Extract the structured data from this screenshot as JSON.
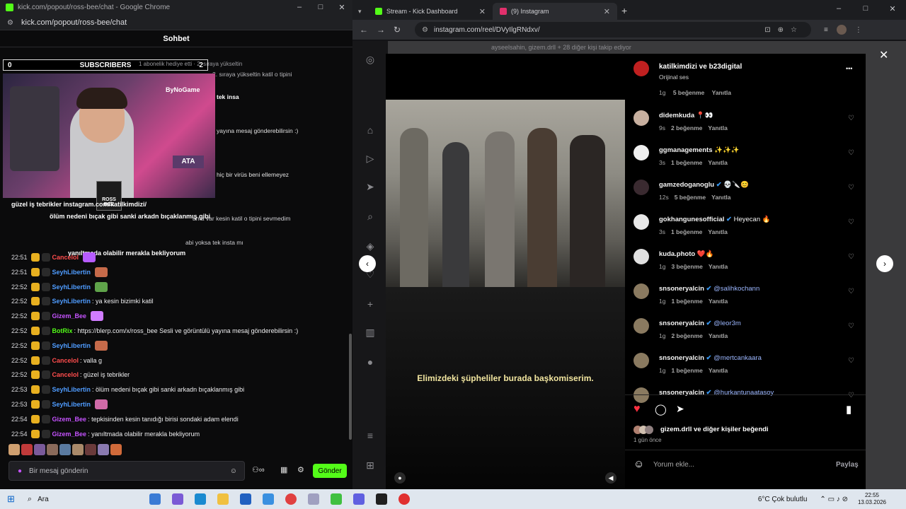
{
  "left_window": {
    "title": "kick.com/popout/ross-bee/chat - Google Chrome",
    "url": "kick.com/popout/ross-bee/chat",
    "controls": [
      "–",
      "□",
      "✕"
    ],
    "chat_title": "Sohbet",
    "sub_bar": {
      "left": "0",
      "center": "SUBSCRIBERS",
      "right": "2"
    },
    "gift_notice": "1 abonelik hediye etti · 2. sıraya yükseltin",
    "overlay_lines": [
      {
        "text": "güzel iş tebrikler instagram.com/katilkimdizi/",
        "color": "#ffffff"
      },
      {
        "text": "ölüm nedeni bıçak gibi sanki arkadn bıçaklanmış gibi",
        "color": "#ffffff"
      },
      {
        "text": "yanıltmada olabilir merakla bekliyorum",
        "color": "#ffffff"
      }
    ],
    "faint_lines": [
      "ban ve tepkisinden kesin tanıdığı birisi sondaki adam elendi",
      "2. sıraya yükseltin katil o tipini",
      "tek insa",
      "yayına mesaj gönderebilirsin :)",
      "hiç bir virüs beni ellemeyez",
      "ama var kesin katil o tipini sevmedim",
      "abi yoksa tek insta mı"
    ],
    "messages": [
      {
        "time": "22:51",
        "user": "Cancelol",
        "user_color": "#ff4d4d",
        "text": "",
        "emote": "#b75cff"
      },
      {
        "time": "22:51",
        "user": "SeyhLibertin",
        "user_color": "#4f9cff",
        "text": "",
        "emote": "#c66a4a"
      },
      {
        "time": "22:52",
        "user": "SeyhLibertin",
        "user_color": "#4f9cff",
        "text": "",
        "emote": "#5fa34a"
      },
      {
        "time": "22:52",
        "user": "SeyhLibertin",
        "user_color": "#4f9cff",
        "text": ": ya kesin bizimki katil",
        "emote": ""
      },
      {
        "time": "22:52",
        "user": "Gizem_Bee",
        "user_color": "#c653ff",
        "text": "",
        "emote": "#d07cff"
      },
      {
        "time": "22:52",
        "user": "BotRix",
        "user_color": "#53fc18",
        "text": ": https://blerp.com/x/ross_bee Sesli ve görüntülü yayına mesaj gönderebilirsin :)",
        "emote": ""
      },
      {
        "time": "22:52",
        "user": "SeyhLibertin",
        "user_color": "#4f9cff",
        "text": "",
        "emote": "#c66a4a"
      },
      {
        "time": "22:52",
        "user": "Cancelol",
        "user_color": "#ff4d4d",
        "text": ": valla g",
        "emote": ""
      },
      {
        "time": "22:52",
        "user": "Cancelol",
        "user_color": "#ff4d4d",
        "text": ": güzel iş tebrikler",
        "emote": ""
      },
      {
        "time": "22:53",
        "user": "SeyhLibertin",
        "user_color": "#4f9cff",
        "text": ": ölüm nedeni bıçak gibi sanki arkadn bıçaklanmış gibi",
        "emote": ""
      },
      {
        "time": "22:53",
        "user": "SeyhLibertin",
        "user_color": "#4f9cff",
        "text": "",
        "emote": "#d06aa8"
      },
      {
        "time": "22:54",
        "user": "Gizem_Bee",
        "user_color": "#c653ff",
        "text": ": tepkisinden kesin tanıdığı birisi sondaki adam elendi",
        "emote": ""
      },
      {
        "time": "22:54",
        "user": "Gizem_Bee",
        "user_color": "#c653ff",
        "text": ": yanıltmada olabilir merakla bekliyorum",
        "emote": ""
      }
    ],
    "input_placeholder": "Bir mesaj gönderin",
    "send_label": "Gönder",
    "cam_label": "ByNoGame",
    "cam_text": "ATA",
    "clapper_text": "ROSS BEE"
  },
  "right_window": {
    "tabs": [
      {
        "label": "Stream - Kick Dashboard",
        "icon_color": "#53fc18"
      },
      {
        "label": "(9) Instagram",
        "icon_color": "#e1306c"
      }
    ],
    "new_tab": "+",
    "controls": [
      "–",
      "□",
      "✕"
    ],
    "url": "instagram.com/reel/DVyIlgRNdxv/",
    "followers_notice": "ayseelsahin, gizem.drll + 28 diğer kişi takip ediyor",
    "post": {
      "author": "katilkimdizi ve b23digital",
      "audio": "Orijinal ses",
      "subtitle": "Elimizdeki şüpheliler burada başkomiserim.",
      "liked_by": "gizem.drll ve diğer kişiler beğendi",
      "time_ago": "1 gün önce",
      "comment_placeholder": "Yorum ekle...",
      "share_label": "Paylaş",
      "more": "•••"
    },
    "first_meta": {
      "time": "1g",
      "likes": "5 beğenme",
      "reply": "Yanıtla"
    },
    "comments": [
      {
        "user": "didemkuda",
        "text": "📍👀",
        "time": "9s",
        "likes": "2 beğenme",
        "reply": "Yanıtla",
        "avatar": "#c8b0a0",
        "verified": false,
        "mention": false
      },
      {
        "user": "ggmanagements",
        "text": "✨✨✨",
        "time": "3s",
        "likes": "1 beğenme",
        "reply": "Yanıtla",
        "avatar": "#f0f0f0",
        "verified": false,
        "mention": false
      },
      {
        "user": "gamzedoganoglu",
        "text": "💀🔪😊",
        "time": "12s",
        "likes": "5 beğenme",
        "reply": "Yanıtla",
        "avatar": "#3a2a30",
        "verified": true,
        "mention": false
      },
      {
        "user": "gokhangunesofficial",
        "text": "Heyecan 🔥",
        "time": "3s",
        "likes": "1 beğenme",
        "reply": "Yanıtla",
        "avatar": "#e8e8e8",
        "verified": true,
        "mention": false
      },
      {
        "user": "kuda.photo",
        "text": "❤️🔥",
        "time": "1g",
        "likes": "3 beğenme",
        "reply": "Yanıtla",
        "avatar": "#e0e0e0",
        "verified": false,
        "mention": false
      },
      {
        "user": "snsoneryalcin",
        "text": "@salihkochann",
        "time": "1g",
        "likes": "1 beğenme",
        "reply": "Yanıtla",
        "avatar": "#8a7a60",
        "verified": true,
        "mention": true
      },
      {
        "user": "snsoneryalcin",
        "text": "@leor3m",
        "time": "1g",
        "likes": "2 beğenme",
        "reply": "Yanıtla",
        "avatar": "#8a7a60",
        "verified": true,
        "mention": true
      },
      {
        "user": "snsoneryalcin",
        "text": "@mertcankaara",
        "time": "1g",
        "likes": "1 beğenme",
        "reply": "Yanıtla",
        "avatar": "#8a7a60",
        "verified": true,
        "mention": true
      },
      {
        "user": "snsoneryalcin",
        "text": "@hurkantunaatasoy",
        "time": "",
        "likes": "",
        "reply": "",
        "avatar": "#8a7a60",
        "verified": true,
        "mention": true
      }
    ]
  },
  "taskbar": {
    "search": "Ara",
    "weather": "6°C  Çok bulutlu",
    "time": "22:55",
    "date": "13.03.2026"
  }
}
